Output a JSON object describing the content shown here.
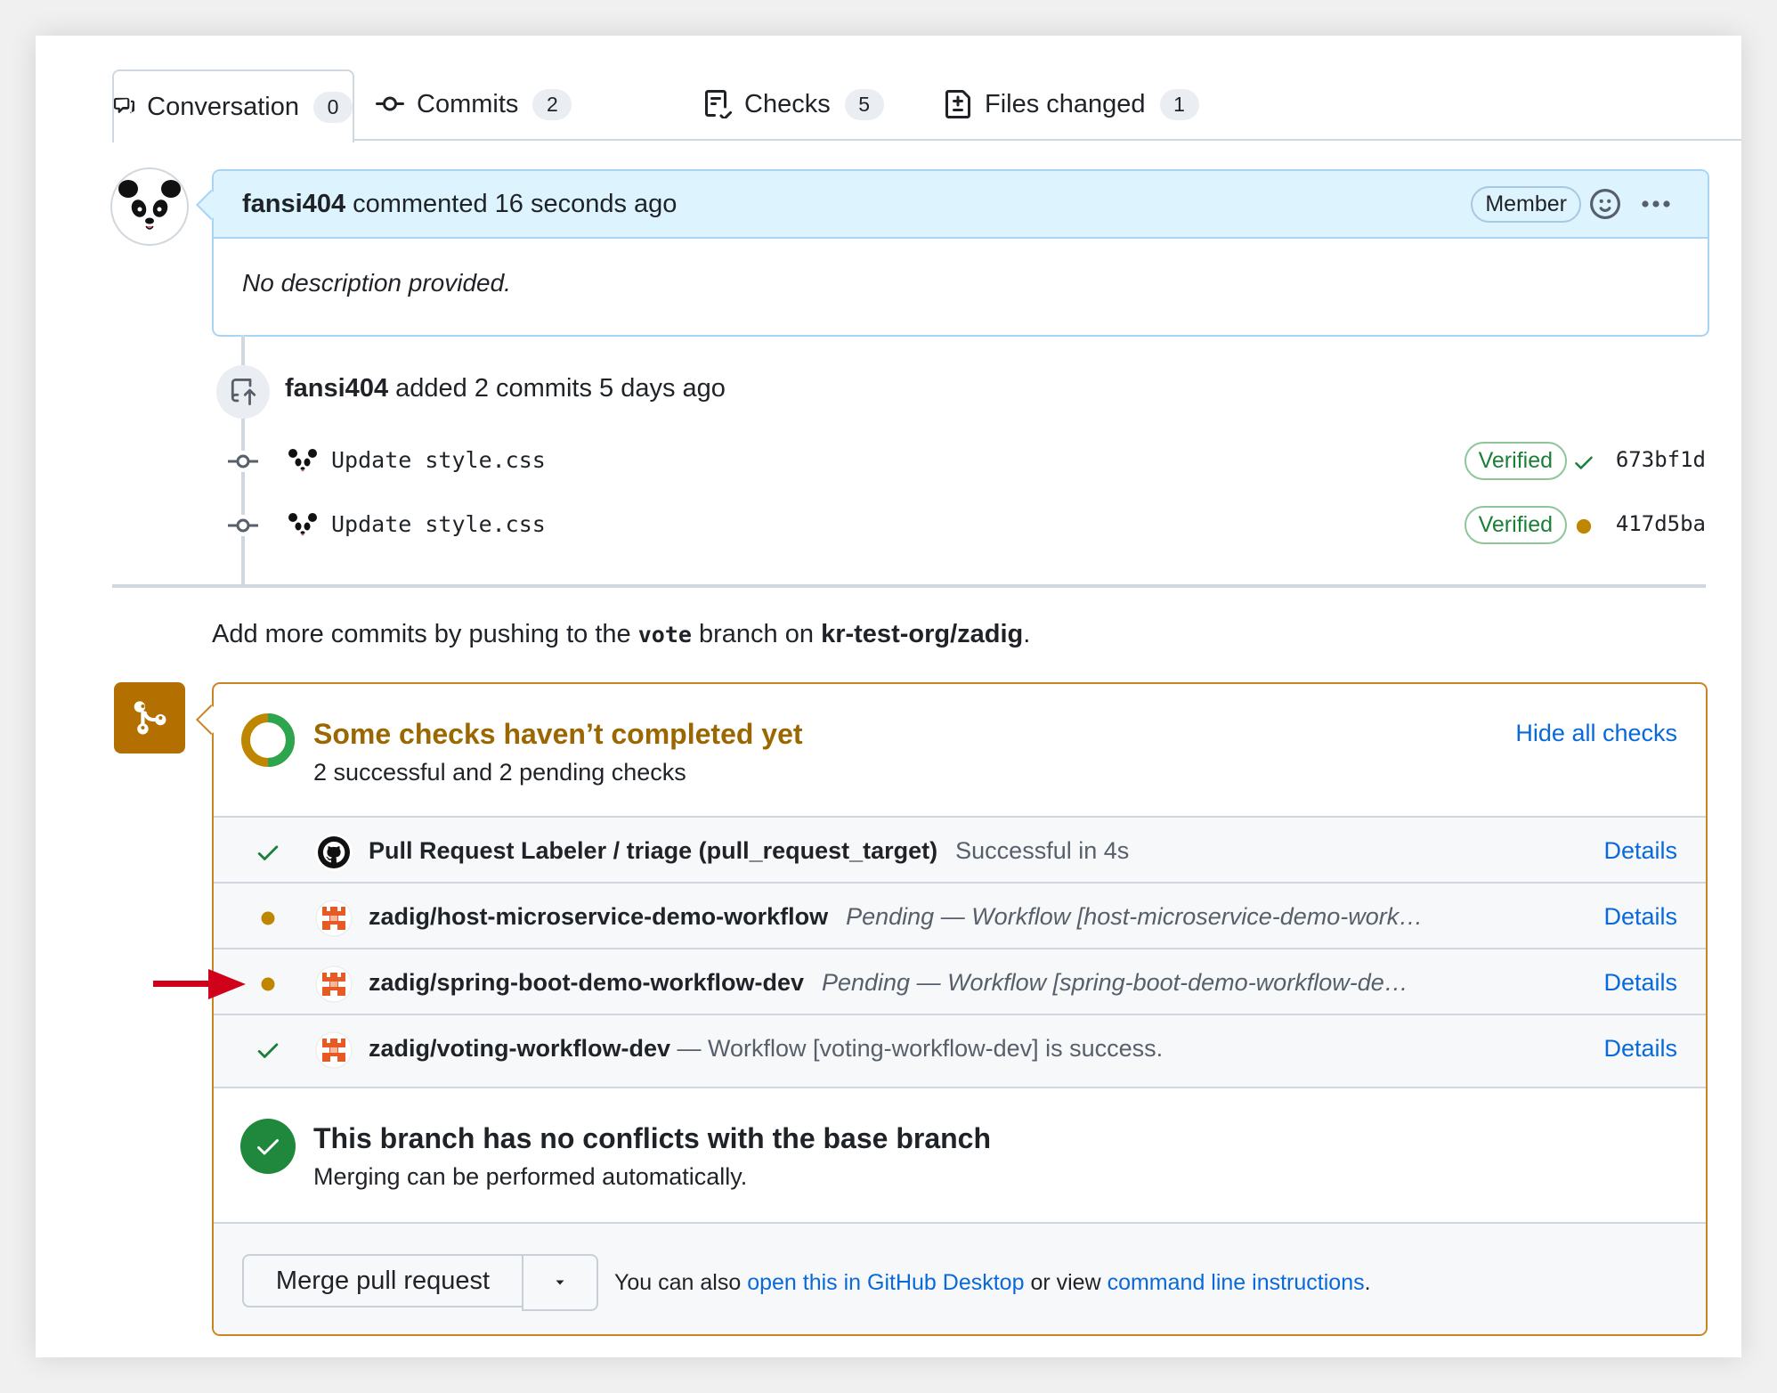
{
  "tabs": [
    {
      "label": "Conversation",
      "count": "0",
      "icon": "comment-discussion-icon"
    },
    {
      "label": "Commits",
      "count": "2",
      "icon": "git-commit-icon"
    },
    {
      "label": "Checks",
      "count": "5",
      "icon": "checklist-icon"
    },
    {
      "label": "Files changed",
      "count": "1",
      "icon": "file-diff-icon"
    }
  ],
  "comment": {
    "author": "fansi404",
    "action": "commented 16 seconds ago",
    "badge": "Member",
    "body": "No description provided."
  },
  "push_event": {
    "author": "fansi404",
    "action": "added 2 commits 5 days ago"
  },
  "commits": [
    {
      "message": "Update style.css",
      "badge": "Verified",
      "status": "success",
      "sha": "673bf1d"
    },
    {
      "message": "Update style.css",
      "badge": "Verified",
      "status": "pending",
      "sha": "417d5ba"
    }
  ],
  "push_hint": {
    "prefix": "Add more commits by pushing to the",
    "branch": "vote",
    "middle": "branch on",
    "repo": "kr-test-org/zadig",
    "suffix": "."
  },
  "checks": {
    "title": "Some checks haven’t completed yet",
    "subtitle": "2 successful and 2 pending checks",
    "hide_label": "Hide all checks",
    "items": [
      {
        "status": "success",
        "app": "github",
        "name": "Pull Request Labeler / triage (pull_request_target)",
        "desc": "Successful in 4s",
        "desc_italic": false,
        "details": "Details"
      },
      {
        "status": "pending",
        "app": "zadig",
        "name": "zadig/host-microservice-demo-workflow",
        "desc": "Pending — Workflow [host-microservice-demo-work…",
        "desc_italic": true,
        "details": "Details"
      },
      {
        "status": "pending",
        "app": "zadig",
        "name": "zadig/spring-boot-demo-workflow-dev",
        "desc": "Pending — Workflow [spring-boot-demo-workflow-de…",
        "desc_italic": true,
        "details": "Details"
      },
      {
        "status": "success",
        "app": "zadig",
        "name": "zadig/voting-workflow-dev",
        "desc": "— Workflow [voting-workflow-dev] is success.",
        "desc_italic": false,
        "details": "Details"
      }
    ]
  },
  "conflicts": {
    "title": "This branch has no conflicts with the base branch",
    "subtitle": "Merging can be performed automatically."
  },
  "merge": {
    "button": "Merge pull request",
    "help_prefix": "You can also",
    "link1": "open this in GitHub Desktop",
    "help_middle": "or view",
    "link2": "command line instructions",
    "help_suffix": "."
  },
  "colors": {
    "accent_blue": "#0969da",
    "success_green": "#1a7f37",
    "pending_orange": "#bf8700",
    "merge_box_border": "#c98524",
    "annotation_red": "#d0021b"
  }
}
